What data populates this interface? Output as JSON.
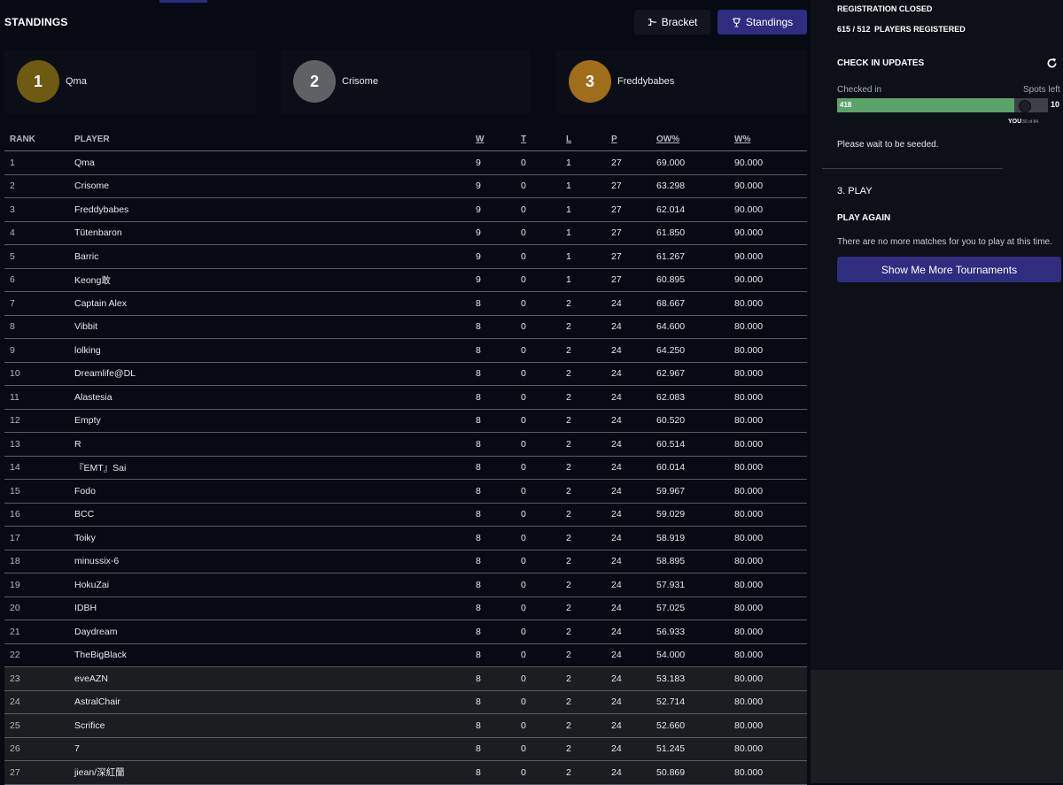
{
  "header": {
    "title": "STANDINGS",
    "bracket_label": "Bracket",
    "standings_label": "Standings"
  },
  "podium": [
    {
      "place": "1",
      "name": "Qma",
      "color": "#6e5a10"
    },
    {
      "place": "2",
      "name": "Crisome",
      "color": "#5f6165"
    },
    {
      "place": "3",
      "name": "Freddybabes",
      "color": "#a06d1a"
    }
  ],
  "table": {
    "columns": [
      "RANK",
      "PLAYER",
      "W",
      "T",
      "L",
      "P",
      "OW%",
      "W%"
    ],
    "rows": [
      [
        "1",
        "Qma",
        "9",
        "0",
        "1",
        "27",
        "69.000",
        "90.000"
      ],
      [
        "2",
        "Crisome",
        "9",
        "0",
        "1",
        "27",
        "63.298",
        "90.000"
      ],
      [
        "3",
        "Freddybabes",
        "9",
        "0",
        "1",
        "27",
        "62.014",
        "90.000"
      ],
      [
        "4",
        "Tütenbaron",
        "9",
        "0",
        "1",
        "27",
        "61.850",
        "90.000"
      ],
      [
        "5",
        "Barric",
        "9",
        "0",
        "1",
        "27",
        "61.267",
        "90.000"
      ],
      [
        "6",
        "Keong敢",
        "9",
        "0",
        "1",
        "27",
        "60.895",
        "90.000"
      ],
      [
        "7",
        "Captain Alex",
        "8",
        "0",
        "2",
        "24",
        "68.667",
        "80.000"
      ],
      [
        "8",
        "Vibbit",
        "8",
        "0",
        "2",
        "24",
        "64.600",
        "80.000"
      ],
      [
        "9",
        "lolking",
        "8",
        "0",
        "2",
        "24",
        "64.250",
        "80.000"
      ],
      [
        "10",
        "Dreamlife@DL",
        "8",
        "0",
        "2",
        "24",
        "62.967",
        "80.000"
      ],
      [
        "11",
        "Alastesia",
        "8",
        "0",
        "2",
        "24",
        "62.083",
        "80.000"
      ],
      [
        "12",
        "Empty",
        "8",
        "0",
        "2",
        "24",
        "60.520",
        "80.000"
      ],
      [
        "13",
        "R",
        "8",
        "0",
        "2",
        "24",
        "60.514",
        "80.000"
      ],
      [
        "14",
        "『EMT』Sai",
        "8",
        "0",
        "2",
        "24",
        "60.014",
        "80.000"
      ],
      [
        "15",
        "Fodo",
        "8",
        "0",
        "2",
        "24",
        "59.967",
        "80.000"
      ],
      [
        "16",
        "BCC",
        "8",
        "0",
        "2",
        "24",
        "59.029",
        "80.000"
      ],
      [
        "17",
        "Toiky",
        "8",
        "0",
        "2",
        "24",
        "58.919",
        "80.000"
      ],
      [
        "18",
        "minussix-6",
        "8",
        "0",
        "2",
        "24",
        "58.895",
        "80.000"
      ],
      [
        "19",
        "HokuZai",
        "8",
        "0",
        "2",
        "24",
        "57.931",
        "80.000"
      ],
      [
        "20",
        "IDBH",
        "8",
        "0",
        "2",
        "24",
        "57.025",
        "80.000"
      ],
      [
        "21",
        "Daydream",
        "8",
        "0",
        "2",
        "24",
        "56.933",
        "80.000"
      ],
      [
        "22",
        "TheBigBlack",
        "8",
        "0",
        "2",
        "24",
        "54.000",
        "80.000"
      ],
      [
        "23",
        "eveAZN",
        "8",
        "0",
        "2",
        "24",
        "53.183",
        "80.000"
      ],
      [
        "24",
        "AstralChair",
        "8",
        "0",
        "2",
        "24",
        "52.714",
        "80.000"
      ],
      [
        "25",
        "Scrifice",
        "8",
        "0",
        "2",
        "24",
        "52.660",
        "80.000"
      ],
      [
        "26",
        "7",
        "8",
        "0",
        "2",
        "24",
        "51.245",
        "80.000"
      ],
      [
        "27",
        "jiean/深紅蘭",
        "8",
        "0",
        "2",
        "24",
        "50.869",
        "80.000"
      ]
    ]
  },
  "sidebar": {
    "registration_status": "REGISTRATION CLOSED",
    "registered_count": "615 / 512",
    "registered_label": "PLAYERS REGISTERED",
    "checkin_title": "CHECK IN UPDATES",
    "checked_in_label": "Checked in",
    "spots_left_label": "Spots left",
    "checked_in_count": "418",
    "spots_left_count": "10",
    "checkin_fraction": 0.84,
    "you_label": "YOU",
    "you_sub": "30 of 84",
    "seed_message": "Please wait to be seeded.",
    "play_title": "3. PLAY",
    "play_again_label": "PLAY AGAIN",
    "play_message": "There are no more matches for you to play at this time.",
    "more_button": "Show Me More Tournaments"
  },
  "colors": {
    "accent": "#2e2d80",
    "progress": "#5aa46a",
    "background": "#070a12"
  }
}
